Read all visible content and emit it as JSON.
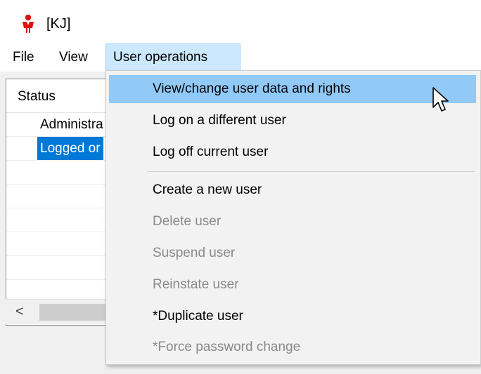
{
  "window": {
    "title": "[KJ]"
  },
  "menubar": {
    "items": [
      {
        "label": "File"
      },
      {
        "label": "View"
      },
      {
        "label": "User operations"
      }
    ]
  },
  "list": {
    "header": "Status",
    "rows": [
      {
        "text": "Administra",
        "selected": false
      },
      {
        "text": "Logged or",
        "selected": true
      }
    ]
  },
  "dropdown": {
    "items": [
      {
        "label": "View/change user data and rights",
        "state": "hover"
      },
      {
        "label": "Log on a different user",
        "state": "enabled"
      },
      {
        "label": "Log off current user",
        "state": "enabled"
      },
      {
        "label": "Create a new user",
        "state": "enabled"
      },
      {
        "label": "Delete user",
        "state": "disabled"
      },
      {
        "label": "Suspend user",
        "state": "disabled"
      },
      {
        "label": "Reinstate user",
        "state": "disabled"
      },
      {
        "label": "*Duplicate user",
        "state": "enabled"
      },
      {
        "label": "*Force password change",
        "state": "disabled"
      }
    ]
  },
  "scrollbar": {
    "left_arrow": "<"
  },
  "colors": {
    "menu_highlight": "#cce8ff",
    "item_hover": "#91c9f7",
    "selection": "#0078d7",
    "disabled_text": "#8a8a8a",
    "icon_red": "#e01010"
  },
  "icons": {
    "app": "person-app-icon",
    "cursor": "mouse-pointer-icon"
  }
}
